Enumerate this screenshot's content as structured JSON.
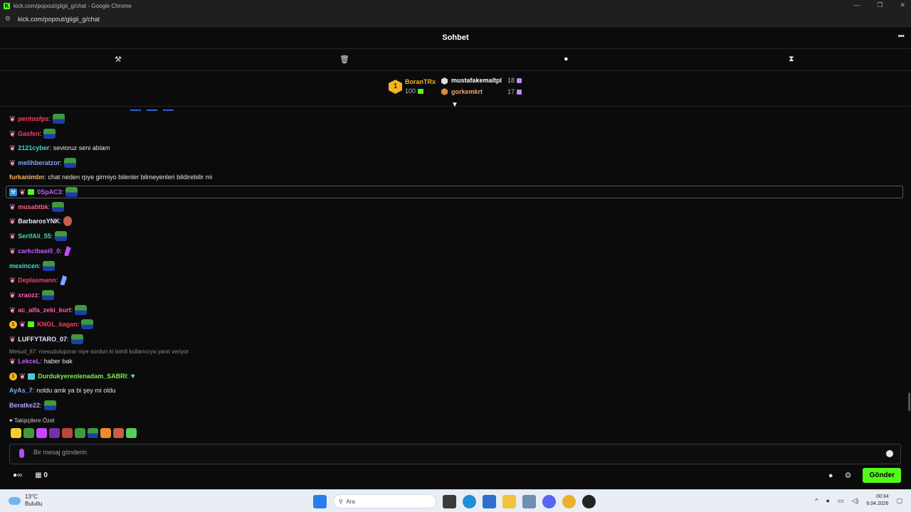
{
  "window": {
    "title": "kick.com/popout/giigii_g/chat - Google Chrome",
    "url": "kick.com/popout/giigii_g/chat",
    "controls": [
      "—",
      "❐",
      "✕"
    ]
  },
  "chat": {
    "title": "Sohbet",
    "more_icon": "•••"
  },
  "leaderboard": {
    "top": {
      "rank": "1",
      "name": "BoranTRx",
      "count": "100"
    },
    "second": {
      "name": "mustafakemaltpl",
      "count": "18"
    },
    "third": {
      "name": "gorkemkrt",
      "count": "17"
    }
  },
  "messages": [
    {
      "user": "pentosfps",
      "color": "#ff3b63",
      "text": "",
      "emote": "pepe",
      "fly": true
    },
    {
      "user": "Gasfen",
      "color": "#ff3b63",
      "text": "",
      "emote": "pepe",
      "fly": true
    },
    {
      "user": "2121cyber",
      "color": "#48d6c8",
      "text": "sevioruz seni ablam",
      "emote": "",
      "fly": true
    },
    {
      "user": "melihberatzor",
      "color": "#79a8ff",
      "text": "",
      "emote": "pepe",
      "fly": true
    },
    {
      "user": "furkanimbn",
      "color": "#f2b55f",
      "text": "chat neden rpye girmiyo bilenler bilmeyenleri bildirebilir mi",
      "emote": "",
      "fly": false
    },
    {
      "user": "0SpAC3",
      "color": "#c35cff",
      "text": "",
      "emote": "pepe",
      "fly": true
    },
    {
      "user": "musabtbk",
      "color": "#ff5c8a",
      "text": "",
      "emote": "pepe",
      "fly": true
    },
    {
      "user": "BarbarosYNK",
      "color": "#e8e8ff",
      "text": "",
      "emote": "face",
      "fly": true
    },
    {
      "user": "SerifAli_55",
      "color": "#48d6a4",
      "text": "",
      "emote": "pepe",
      "fly": true
    },
    {
      "user": "carkcibasi0_0",
      "color": "#c35cff",
      "text": "",
      "emote": "wing",
      "fly": true
    },
    {
      "user": "mexincen",
      "color": "#48d6c8",
      "text": "",
      "emote": "pepe",
      "fly": false
    },
    {
      "user": "Deplasmann",
      "color": "#ff3b63",
      "text": "",
      "emote": "wing-blue",
      "fly": true
    },
    {
      "user": "xraozz",
      "color": "#ff5ca8",
      "text": "",
      "emote": "pepe",
      "fly": true
    },
    {
      "user": "ac_alfa_zeki_kurt",
      "color": "#ff5ca8",
      "text": "",
      "emote": "pepe",
      "fly": true
    },
    {
      "user": "KNGL_kagan",
      "color": "#ff3b63",
      "text": "",
      "emote": "pepe",
      "fly": true
    },
    {
      "user": "LUFFYTARO_07",
      "color": "#e8e8ff",
      "text": "",
      "emote": "pepe",
      "fly": true
    },
    {
      "user": "LekceL",
      "color": "#c35cff",
      "text": "haber bak",
      "emote": "",
      "fly": true
    },
    {
      "user": "Durdukyereolenadam_SABRI",
      "color": "#7cf04a",
      "text": "",
      "emote": "heart",
      "fly": true
    },
    {
      "user": "AyAs_7",
      "color": "#79a8ff",
      "text": "noldu amk ya bi şey mi oldu",
      "emote": "",
      "fly": false
    },
    {
      "user": "Beratke22",
      "color": "#b59cff",
      "text": "",
      "emote": "pepe",
      "fly": false
    }
  ],
  "reply_line": "Mesud_67: mesudulupınar niye sordun ki isimli kullanıcıya yanıt veriyor",
  "followers_label": "Takipçilere Özel",
  "input": {
    "placeholder": "Bir mesaj gönderin"
  },
  "bottom": {
    "count": "0",
    "send_label": "Gönder"
  },
  "taskbar": {
    "temp": "13°C",
    "weather": "Bulutlu",
    "search": "Ara",
    "time": "00:34",
    "date": "6.04.2026"
  },
  "colors": {
    "accent": "#53fc18",
    "gold": "#f2b51f"
  }
}
